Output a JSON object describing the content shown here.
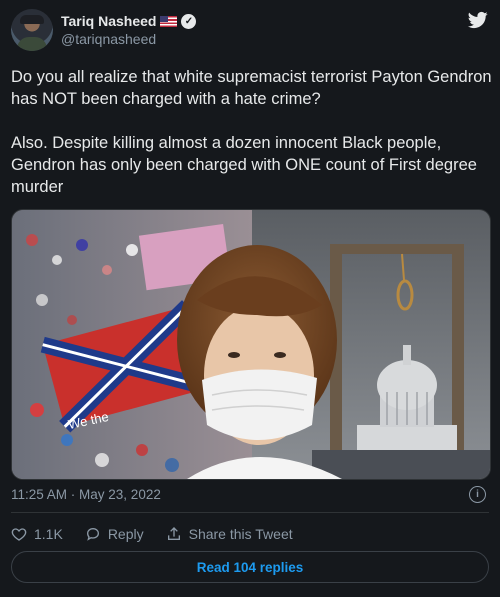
{
  "author": {
    "name": "Tariq Nasheed",
    "handle": "@tariqnasheed",
    "flag_icon": "us-flag-icon",
    "verified_icon": "verified-badge-icon"
  },
  "tweet": {
    "paragraph_1": "Do you all realize that white supremacist terrorist Payton Gendron has NOT been charged with a hate crime?",
    "paragraph_2": "Also. Despite killing almost a dozen innocent Black people, Gendron has only been charged with ONE count of First degree murder",
    "media_sign_text": "We the"
  },
  "meta": {
    "timestamp": "11:25 AM · May 23, 2022",
    "info_icon": "info-icon"
  },
  "actions": {
    "likes": "1.1K",
    "reply_label": "Reply",
    "share_label": "Share this Tweet"
  },
  "read_replies_label": "Read 104 replies",
  "colors": {
    "background": "#15181c",
    "text": "#e7e9ea",
    "muted": "#8b98a5",
    "accent": "#1d9bf0",
    "border": "#2f3336"
  }
}
